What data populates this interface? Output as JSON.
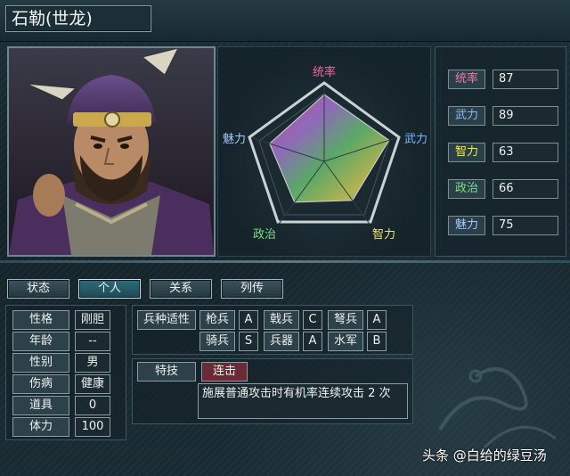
{
  "header": {
    "title": "石勒(世龙)"
  },
  "radar": {
    "labels": {
      "tongshuai": "统率",
      "wuli": "武力",
      "zhili": "智力",
      "zhengzhi": "政治",
      "meili": "魅力"
    },
    "colors": {
      "tongshuai": "#f06aa0",
      "wuli": "#7fb3ff",
      "zhili": "#f2e85a",
      "zhengzhi": "#7fe07f",
      "meili": "#a6c8ff"
    }
  },
  "stats": [
    {
      "label": "统率",
      "value": "87",
      "color": "#f07aa6"
    },
    {
      "label": "武力",
      "value": "89",
      "color": "#8cb8ff"
    },
    {
      "label": "智力",
      "value": "63",
      "color": "#f2e85a"
    },
    {
      "label": "政治",
      "value": "66",
      "color": "#7fe07f"
    },
    {
      "label": "魅力",
      "value": "75",
      "color": "#a6c8ff"
    }
  ],
  "tabs": [
    "状态",
    "个人",
    "关系",
    "列传"
  ],
  "personal": [
    {
      "label": "性格",
      "value": "刚胆"
    },
    {
      "label": "年龄",
      "value": "--"
    },
    {
      "label": "性别",
      "value": "男"
    },
    {
      "label": "伤病",
      "value": "健康"
    },
    {
      "label": "道具",
      "value": "0"
    },
    {
      "label": "体力",
      "value": "100"
    }
  ],
  "aptitude": {
    "label": "兵种适性",
    "items": [
      {
        "name": "枪兵",
        "grade": "A"
      },
      {
        "name": "戟兵",
        "grade": "C"
      },
      {
        "name": "弩兵",
        "grade": "A"
      },
      {
        "name": "骑兵",
        "grade": "S"
      },
      {
        "name": "兵器",
        "grade": "A"
      },
      {
        "name": "水军",
        "grade": "B"
      }
    ]
  },
  "skill": {
    "label": "特技",
    "name": "连击",
    "description": "施展普通攻击时有机率连续攻击 2 次"
  },
  "watermark": "头条 @白给的绿豆汤"
}
